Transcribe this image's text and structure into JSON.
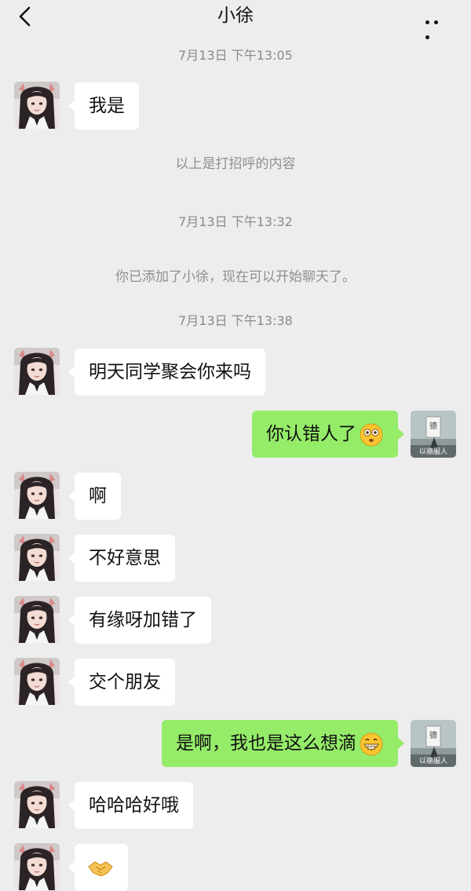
{
  "header": {
    "title": "小徐",
    "back_icon": "chevron-left-icon",
    "more_icon": "more-dots-icon"
  },
  "messages": {
    "ts1": "7月13日 下午13:05",
    "m1": "我是",
    "notice1": "以上是打招呼的内容",
    "ts2": "7月13日 下午13:32",
    "notice2": "你已添加了小徐，现在可以开始聊天了。",
    "ts3": "7月13日 下午13:38",
    "m2": "明天同学聚会你来吗",
    "m3": "你认错人了",
    "m3_emoji": "flushed-face-emoji",
    "m4": "啊",
    "m5": "不好意思",
    "m6": "有缘呀加错了",
    "m7": "交个朋友",
    "m8": "是啊，我也是这么想滴",
    "m8_emoji": "grinning-face-emoji",
    "m9": "哈哈哈好哦",
    "m10_emoji": "handshake-emoji"
  },
  "self_avatar": {
    "caption": "以德服人",
    "glyph": "德"
  },
  "colors": {
    "background": "#ededed",
    "bubble_received": "#ffffff",
    "bubble_sent": "#95ec69",
    "timestamp_text": "#8a8a8a"
  }
}
